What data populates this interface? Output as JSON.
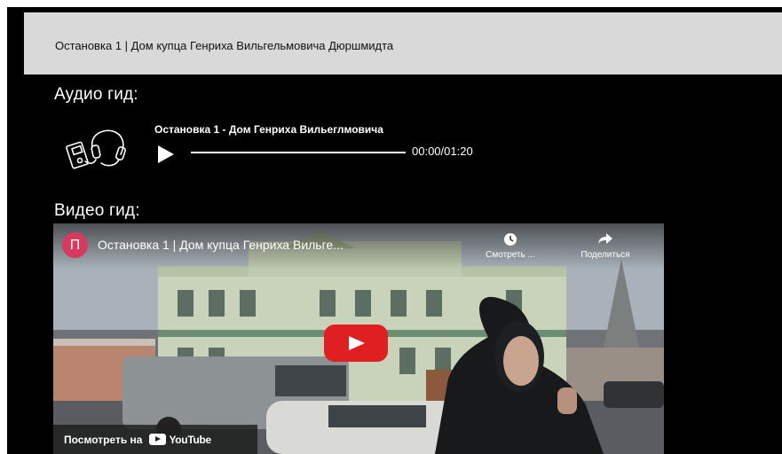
{
  "breadcrumb": {
    "text": "Остановка 1 | Дом купца Генриха Вильгельмовича Дюршмидта"
  },
  "audio_section": {
    "heading": "Аудио гид:",
    "icon": "audio-guide-headphones-icon",
    "player": {
      "track_title": "Остановка 1 - Дом Генриха Вильеглмовича",
      "play_icon": "play-icon",
      "time": "00:00/01:20",
      "progress": 0
    }
  },
  "video_section": {
    "heading": "Видео гид:",
    "embed": {
      "channel_initial": "П",
      "channel_color": "#d63a5e",
      "title": "Остановка 1 | Дом купца Генриха Вильге...",
      "watch_later_label": "Смотреть ...",
      "watch_later_icon": "clock-icon",
      "share_label": "Поделиться",
      "share_icon": "share-arrow-icon",
      "play_button_color": "#e02020",
      "watch_on_label": "Посмотреть на",
      "youtube_wordmark": "YouTube"
    }
  }
}
